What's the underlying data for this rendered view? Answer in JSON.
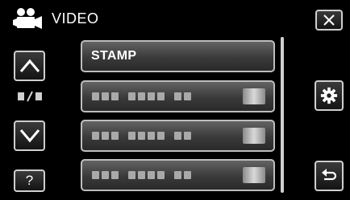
{
  "header": {
    "mode_icon": "video-camera-icon",
    "title": "VIDEO"
  },
  "nav": {
    "up_icon": "chevron-up-icon",
    "down_icon": "chevron-down-icon",
    "page_indicator_icon": "page-indicator-icon",
    "help_label": "?"
  },
  "list": {
    "items": [
      {
        "label": "STAMP"
      },
      {
        "label": ""
      },
      {
        "label": ""
      },
      {
        "label": ""
      }
    ]
  },
  "right": {
    "close_icon": "close-icon",
    "settings_icon": "gear-icon",
    "back_icon": "back-return-icon"
  },
  "colors": {
    "background": "#000000",
    "button_border": "#cfcfcf",
    "item_fill": "#4a4a4a",
    "text": "#ffffff"
  }
}
